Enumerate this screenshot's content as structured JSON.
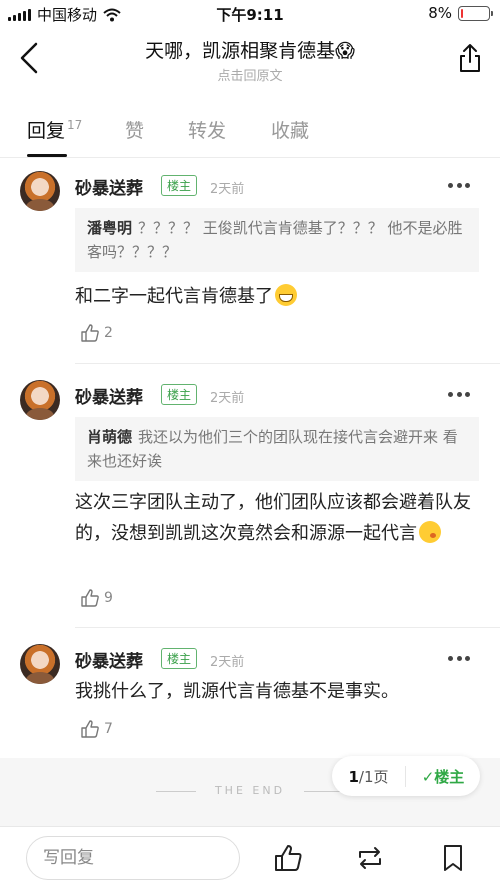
{
  "status_bar": {
    "carrier": "中国移动",
    "time": "下午9:11",
    "battery": "8%",
    "battery_level": 0.08
  },
  "header": {
    "title": "天哪，凯源相聚肯德基😱",
    "subtitle": "点击回原文"
  },
  "tabs": [
    {
      "label": "回复",
      "count": "17"
    },
    {
      "label": "赞"
    },
    {
      "label": "转发"
    },
    {
      "label": "收藏"
    }
  ],
  "comments": [
    {
      "username": "砂暴送葬",
      "badge": "楼主",
      "time": "2天前",
      "quote_name": "潘粤明",
      "quote_text": "？？？？ 王俊凯代言肯德基了？？？ 他不是必胜客吗？？？？",
      "text": "和二字一起代言肯德基了",
      "likes": "2"
    },
    {
      "username": "砂暴送葬",
      "badge": "楼主",
      "time": "2天前",
      "quote_name": "肖萌德",
      "quote_text": "我还以为他们三个的团队现在接代言会避开来 看来也还好诶",
      "text": "这次三字团队主动了，他们团队应该都会避着队友的，没想到凯凯这次竟然会和源源一起代言",
      "likes": "9"
    },
    {
      "username": "砂暴送葬",
      "badge": "楼主",
      "time": "2天前",
      "text": "我挑什么了，凯源代言肯德基不是事实。",
      "likes": "7"
    }
  ],
  "end_text": "THE END",
  "pager": {
    "current": "1",
    "total": "/1页",
    "louzhu": "✓楼主"
  },
  "bottom": {
    "reply_placeholder": "写回复"
  },
  "colors": {
    "accent_green": "#2fa845",
    "battery_low": "#e33"
  }
}
